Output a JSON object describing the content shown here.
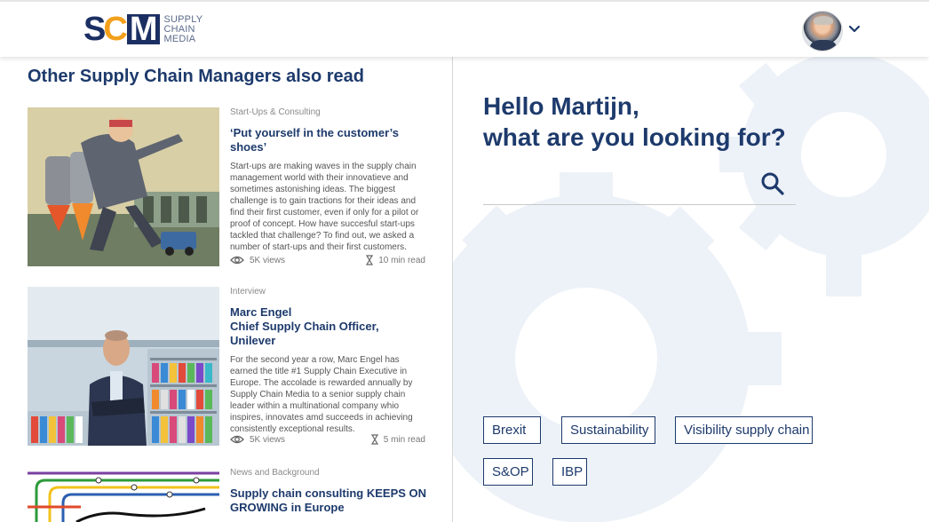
{
  "header": {
    "logo": {
      "mark_s": "S",
      "mark_c": "C",
      "mark_m": "M",
      "line1": "SUPPLY",
      "line2": "CHAIN",
      "line3": "MEDIA"
    },
    "avatar_icon": "user-avatar",
    "menu_icon": "chevron-down-icon"
  },
  "left": {
    "title": "Other Supply Chain Managers also read",
    "articles": [
      {
        "category": "Start-Ups & Consulting",
        "title": "‘Put yourself in the customer’s shoes’",
        "excerpt": "Start-ups are making waves in the supply chain management world with their innovatieve and sometimes astonishing ideas. The biggest challenge is to gain tractions for their ideas and find their first customer, even if only for a pilot or proof of concept. How have succesful start-ups tackled that challenge? To find out, we asked a number of start-ups and their first customers.",
        "views": "5K views",
        "read_time": "10 min read"
      },
      {
        "category": "Interview",
        "title": "Marc Engel\nChief Supply Chain Officer, Unilever",
        "excerpt": "For the second year a row, Marc Engel has earned the title #1 Supply Chain Executive in Europe. The accolade is rewarded annually by Supply Chain Media to a senior supply chain leader within a multinational company whio inspires, innovates amd succeeds in achieving consistently exceptional results.",
        "views": "5K views",
        "read_time": "5 min read"
      },
      {
        "category": "News and Background",
        "title": "Supply chain consulting KEEPS ON GROWING in Europe"
      }
    ]
  },
  "right": {
    "greeting_line1": "Hello Martijn,",
    "greeting_line2": "what are you looking for?",
    "search": {
      "value": "",
      "placeholder": "",
      "icon": "search-icon"
    },
    "tags": [
      "Brexit",
      "Sustainability",
      "Visibility supply chain",
      "S&OP",
      "IBP"
    ]
  },
  "colors": {
    "brand_navy": "#1d3a6c",
    "brand_orange": "#f2a01c",
    "gear_bg": "#e9eff6"
  }
}
